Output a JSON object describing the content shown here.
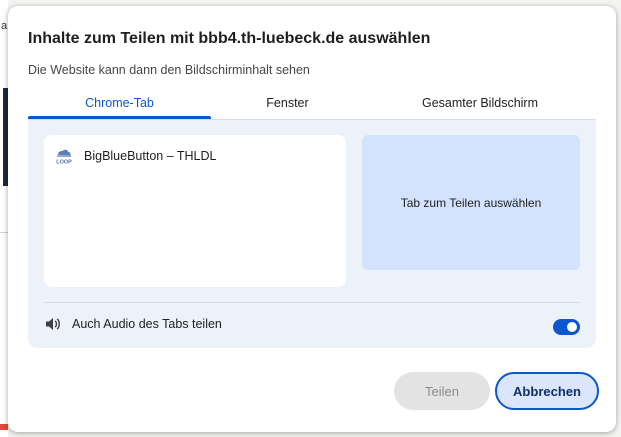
{
  "background": {
    "fragment_text": "a"
  },
  "dialog": {
    "title": "Inhalte zum Teilen mit bbb4.th-luebeck.de auswählen",
    "subtitle": "Die Website kann dann den Bildschirminhalt sehen",
    "tabs": [
      {
        "label": "Chrome-Tab",
        "active": true
      },
      {
        "label": "Fenster",
        "active": false
      },
      {
        "label": "Gesamter Bildschirm",
        "active": false
      }
    ],
    "tab_list": {
      "items": [
        {
          "label": "BigBlueButton – THLDL",
          "icon": "bbb-loop-favicon-icon",
          "favicon_text": "LOOP"
        }
      ]
    },
    "preview": {
      "placeholder": "Tab zum Teilen auswählen"
    },
    "audio": {
      "label": "Auch Audio des Tabs teilen",
      "icon": "speaker-icon",
      "enabled": true
    },
    "buttons": {
      "share_label": "Teilen",
      "cancel_label": "Abbrechen"
    },
    "colors": {
      "accent": "#0b57d0",
      "panel_bg": "#edf2fa",
      "preview_bg": "#d3e3fd"
    }
  }
}
